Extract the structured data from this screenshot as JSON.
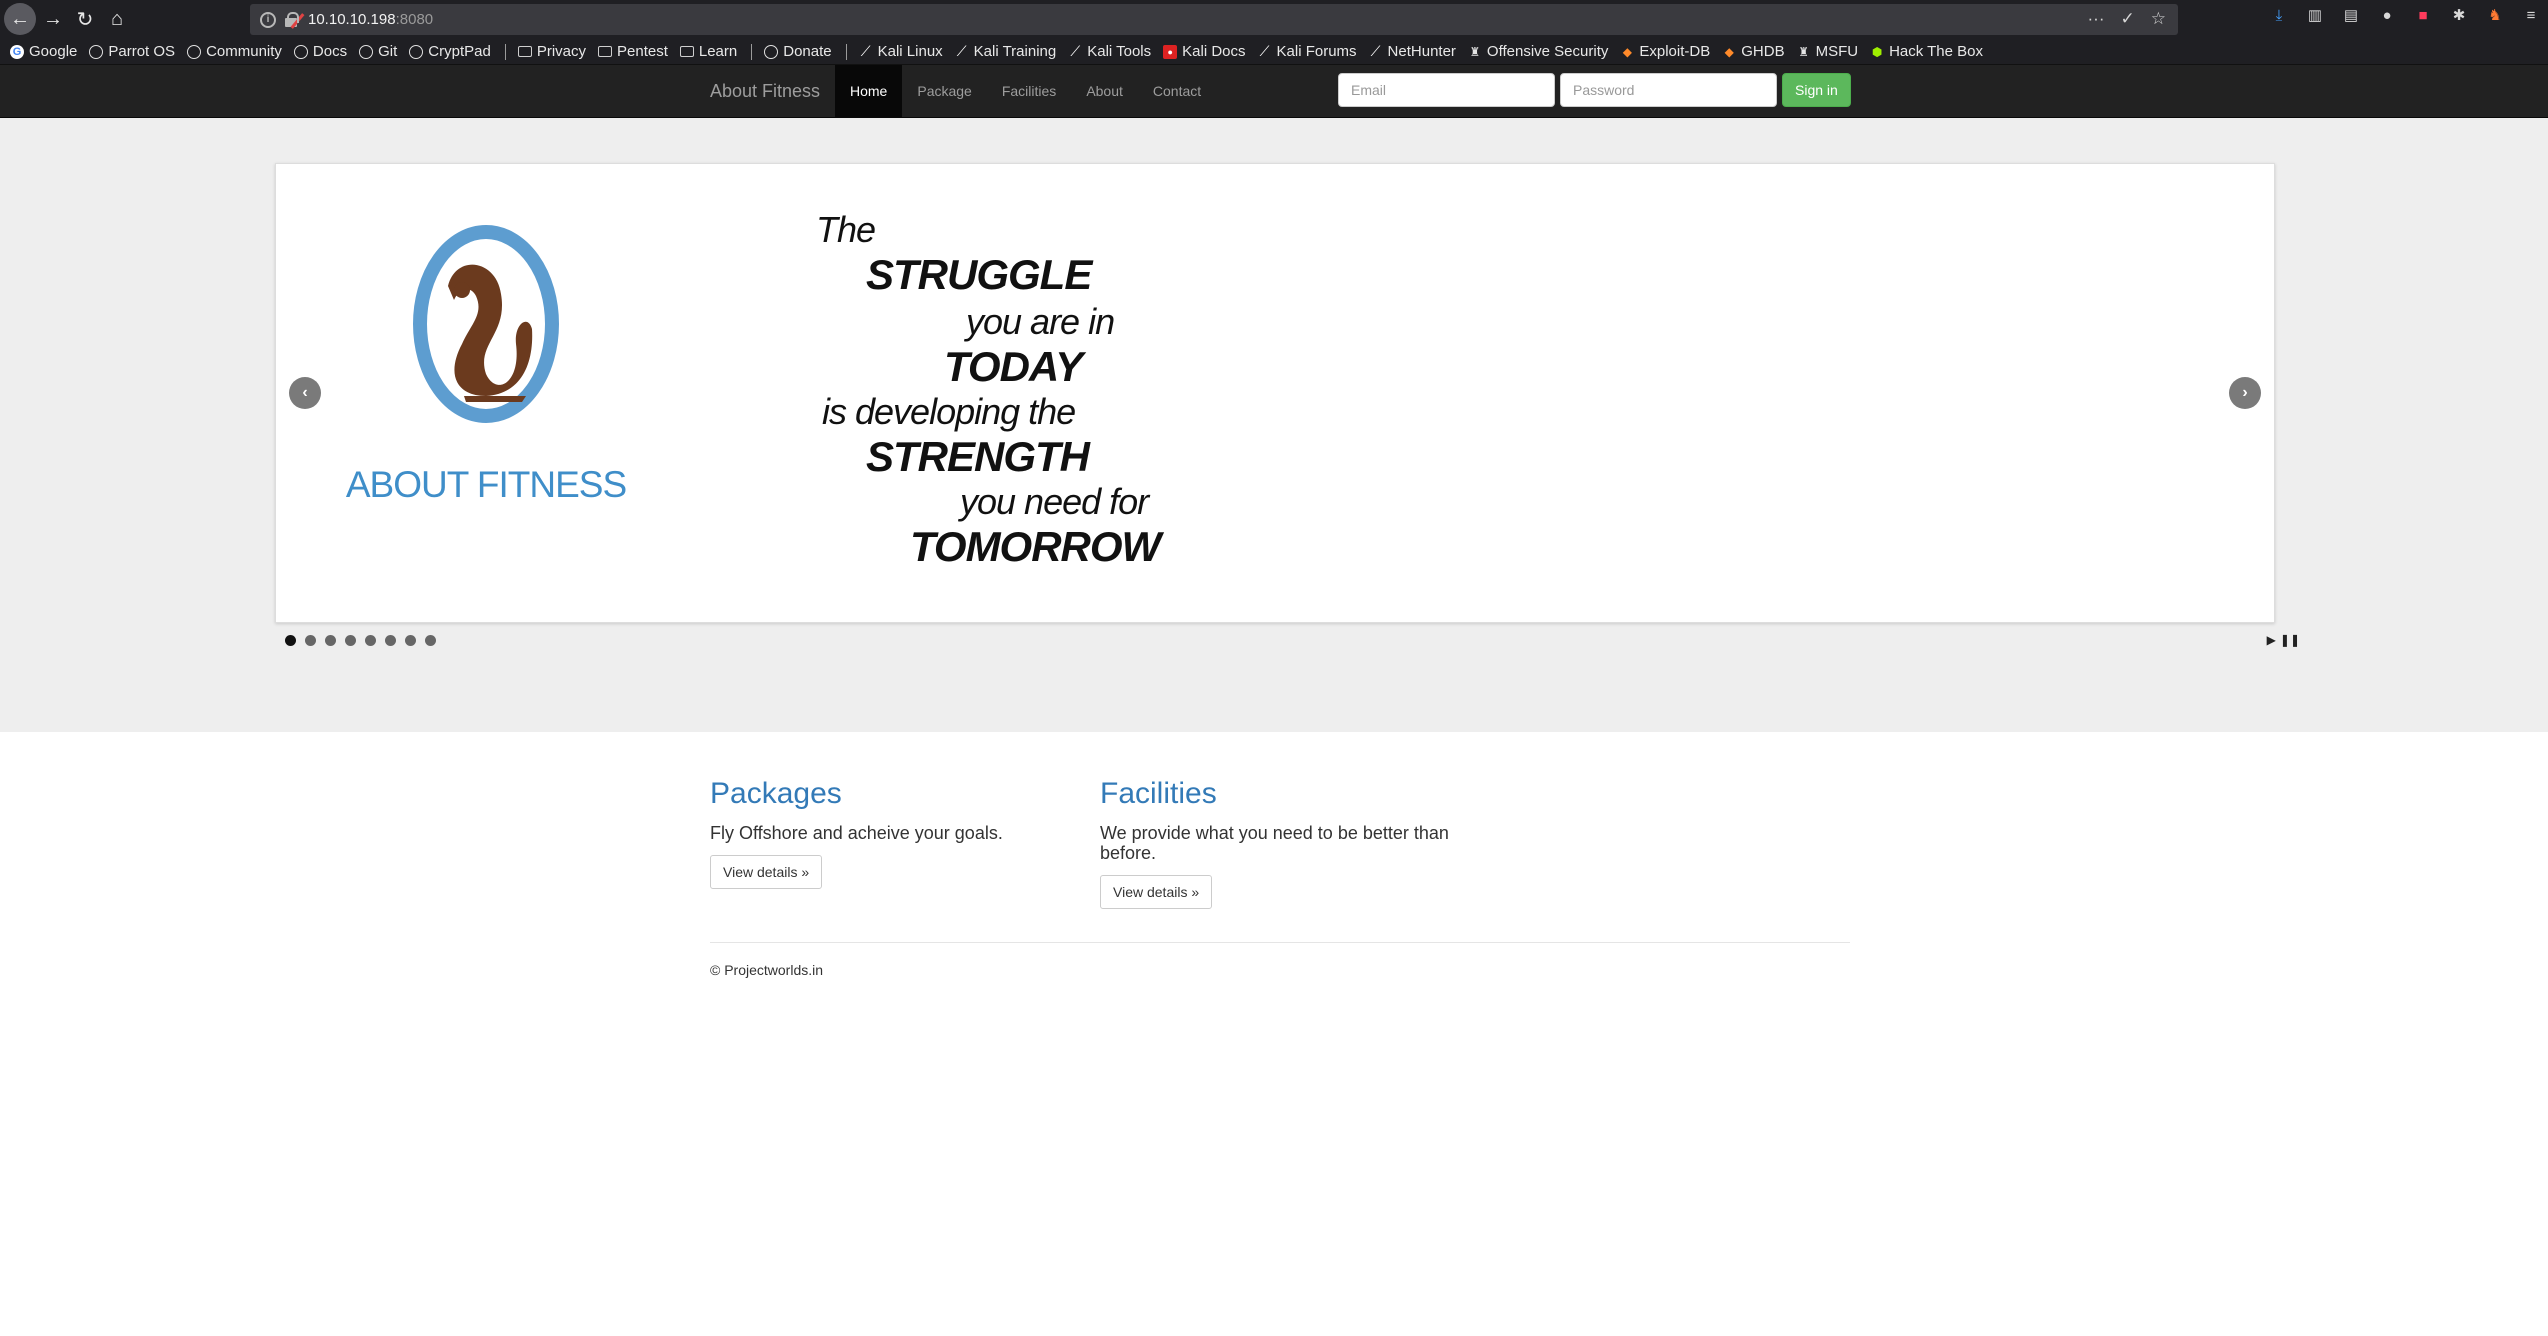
{
  "browser": {
    "url_host": "10.10.10.198",
    "url_port": ":8080",
    "url_actions": [
      "···",
      "✓",
      "☆"
    ],
    "bookmarks": [
      {
        "label": "Google",
        "icon": "google-icon"
      },
      {
        "label": "Parrot OS",
        "icon": "globe-icon"
      },
      {
        "label": "Community",
        "icon": "globe-icon"
      },
      {
        "label": "Docs",
        "icon": "globe-icon"
      },
      {
        "label": "Git",
        "icon": "globe-icon"
      },
      {
        "label": "CryptPad",
        "icon": "globe-icon"
      },
      {
        "label": "Privacy",
        "icon": "folder-icon"
      },
      {
        "label": "Pentest",
        "icon": "folder-icon"
      },
      {
        "label": "Learn",
        "icon": "folder-icon"
      },
      {
        "label": "Donate",
        "icon": "globe-icon"
      },
      {
        "label": "Kali Linux",
        "icon": "kali-icon"
      },
      {
        "label": "Kali Training",
        "icon": "kali-icon"
      },
      {
        "label": "Kali Tools",
        "icon": "kali-icon"
      },
      {
        "label": "Kali Docs",
        "icon": "kali-docs-icon"
      },
      {
        "label": "Kali Forums",
        "icon": "kali-icon"
      },
      {
        "label": "NetHunter",
        "icon": "kali-icon"
      },
      {
        "label": "Offensive Security",
        "icon": "offsec-icon"
      },
      {
        "label": "Exploit-DB",
        "icon": "exploit-db-icon"
      },
      {
        "label": "GHDB",
        "icon": "exploit-db-icon"
      },
      {
        "label": "MSFU",
        "icon": "offsec-icon"
      },
      {
        "label": "Hack The Box",
        "icon": "htb-icon"
      }
    ]
  },
  "navbar": {
    "brand": "About Fitness",
    "links": [
      {
        "label": "Home",
        "active": true
      },
      {
        "label": "Package",
        "active": false
      },
      {
        "label": "Facilities",
        "active": false
      },
      {
        "label": "About",
        "active": false
      },
      {
        "label": "Contact",
        "active": false
      }
    ],
    "email_placeholder": "Email",
    "password_placeholder": "Password",
    "signin_label": "Sign in"
  },
  "carousel": {
    "logo_text": "ABOUT FITNESS",
    "quote_lines": [
      "The",
      "STRUGGLE",
      "you are in",
      "TODAY",
      "is developing the",
      "STRENGTH",
      "you need for",
      "TOMORROW"
    ],
    "slide_count": 8,
    "active_slide": 1,
    "prev_icon": "‹",
    "next_icon": "›",
    "play_icon": "▶",
    "pause_icon": "❚❚"
  },
  "sections": {
    "packages": {
      "title": "Packages",
      "text": "Fly Offshore and acheive your goals.",
      "button": "View details »"
    },
    "facilities": {
      "title": "Facilities",
      "text": "We provide what you need to be better than before.",
      "button": "View details »"
    }
  },
  "footer": {
    "copyright": "© Projectworlds.in"
  },
  "colors": {
    "navbar_bg": "#222222",
    "link_blue": "#337ab7",
    "success_green": "#5cb85c",
    "jumbotron_bg": "#eeeeee",
    "logo_blue": "#3f8ec9",
    "logo_brown": "#6b3a1e"
  }
}
